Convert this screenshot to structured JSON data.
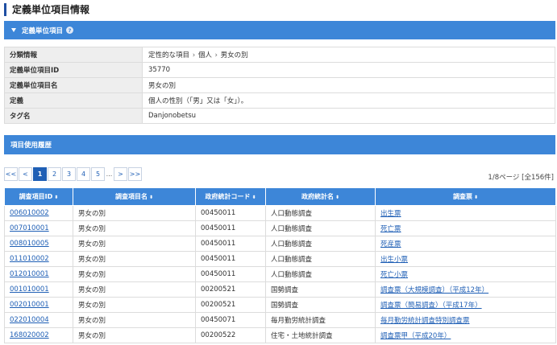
{
  "page_title": "定義単位項目情報",
  "section1": {
    "title": "定義単位項目",
    "help": "?"
  },
  "info": {
    "category_label": "分類情報",
    "category_parts": [
      "定性的な項目",
      "個人",
      "男女の別"
    ],
    "category_sep": "›",
    "id_label": "定義単位項目ID",
    "id_value": "35770",
    "name_label": "定義単位項目名",
    "name_value": "男女の別",
    "def_label": "定義",
    "def_value": "個人の性別（「男」又は「女」）。",
    "tag_label": "タグ名",
    "tag_value": "Danjonobetsu"
  },
  "section2": {
    "title": "項目使用履歴"
  },
  "pager": {
    "first": "<<",
    "prev": "<",
    "pages": [
      "1",
      "2",
      "3",
      "4",
      "5"
    ],
    "dots": "...",
    "next": ">",
    "last": ">>",
    "summary": "1/8ページ [全156件]"
  },
  "table": {
    "sort_glyph": "⬍",
    "headers": [
      "調査項目ID",
      "調査項目名",
      "政府統計コード",
      "政府統計名",
      "調査票"
    ],
    "rows": [
      [
        "006010002",
        "男女の別",
        "00450011",
        "人口動態調査",
        "出生票"
      ],
      [
        "007010001",
        "男女の別",
        "00450011",
        "人口動態調査",
        "死亡票"
      ],
      [
        "008010005",
        "男女の別",
        "00450011",
        "人口動態調査",
        "死産票"
      ],
      [
        "011010002",
        "男女の別",
        "00450011",
        "人口動態調査",
        "出生小票"
      ],
      [
        "012010001",
        "男女の別",
        "00450011",
        "人口動態調査",
        "死亡小票"
      ],
      [
        "001010001",
        "男女の別",
        "00200521",
        "国勢調査",
        "調査票（大規模調査）（平成12年）"
      ],
      [
        "002010001",
        "男女の別",
        "00200521",
        "国勢調査",
        "調査票（簡易調査）（平成17年）"
      ],
      [
        "022010004",
        "男女の別",
        "00450071",
        "毎月勤労統計調査",
        "毎月勤労統計調査特別調査票"
      ],
      [
        "168020002",
        "男女の別",
        "00200522",
        "住宅・土地統計調査",
        "調査票甲（平成20年）"
      ]
    ]
  }
}
